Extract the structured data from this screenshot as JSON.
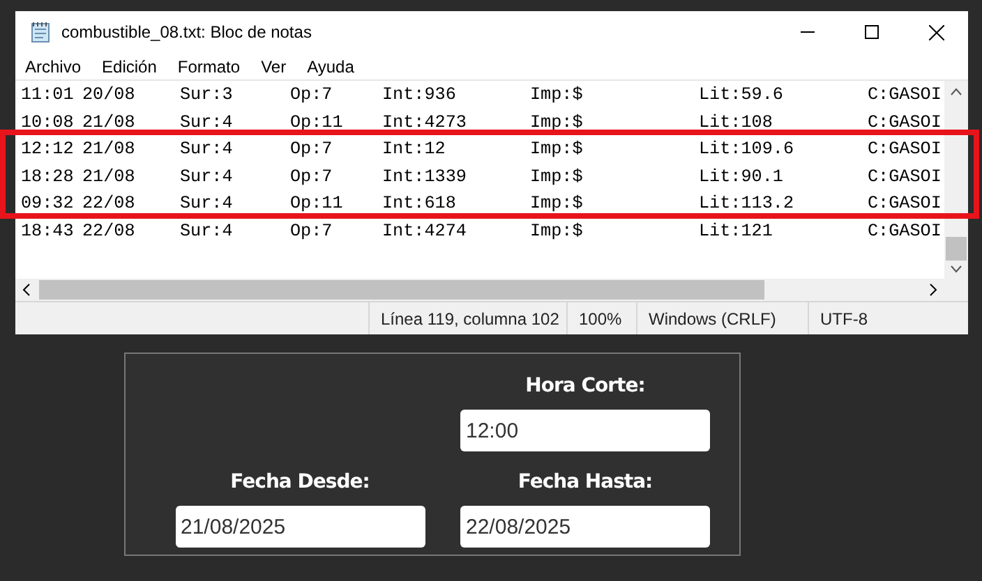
{
  "window": {
    "title": "combustible_08.txt: Bloc de notas"
  },
  "menu": [
    "Archivo",
    "Edición",
    "Formato",
    "Ver",
    "Ayuda"
  ],
  "lines": [
    {
      "time": "11:01",
      "date": "20/08",
      "sur": "Sur:3",
      "op": "Op:7",
      "int": "Int:936",
      "imp": "Imp:$",
      "lit": "Lit:59.6",
      "c": "C:GASOI",
      "highlighted": false
    },
    {
      "time": "10:08",
      "date": "21/08",
      "sur": "Sur:4",
      "op": "Op:11",
      "int": "Int:4273",
      "imp": "Imp:$",
      "lit": "Lit:108",
      "c": "C:GASOI",
      "highlighted": false
    },
    {
      "time": "12:12",
      "date": "21/08",
      "sur": "Sur:4",
      "op": "Op:7",
      "int": "Int:12",
      "imp": "Imp:$",
      "lit": "Lit:109.6",
      "c": "C:GASOI",
      "highlighted": true
    },
    {
      "time": "18:28",
      "date": "21/08",
      "sur": "Sur:4",
      "op": "Op:7",
      "int": "Int:1339",
      "imp": "Imp:$",
      "lit": "Lit:90.1",
      "c": "C:GASOI",
      "highlighted": true
    },
    {
      "time": "09:32",
      "date": "22/08",
      "sur": "Sur:4",
      "op": "Op:11",
      "int": "Int:618",
      "imp": "Imp:$",
      "lit": "Lit:113.2",
      "c": "C:GASOI",
      "highlighted": true
    },
    {
      "time": "18:43",
      "date": "22/08",
      "sur": "Sur:4",
      "op": "Op:7",
      "int": "Int:4274",
      "imp": "Imp:$",
      "lit": "Lit:121",
      "c": "C:GASOI",
      "highlighted": false
    }
  ],
  "status_bar": [
    "Línea 119, columna 102",
    "100%",
    "Windows (CRLF)",
    "UTF-8"
  ],
  "form": {
    "cut_time": {
      "label": "Hora Corte:",
      "value": "12:00"
    },
    "range": [
      {
        "label": "Fecha Desde:",
        "value": "21/08/2025"
      },
      {
        "label": "Fecha Hasta:",
        "value": "22/08/2025"
      }
    ]
  }
}
